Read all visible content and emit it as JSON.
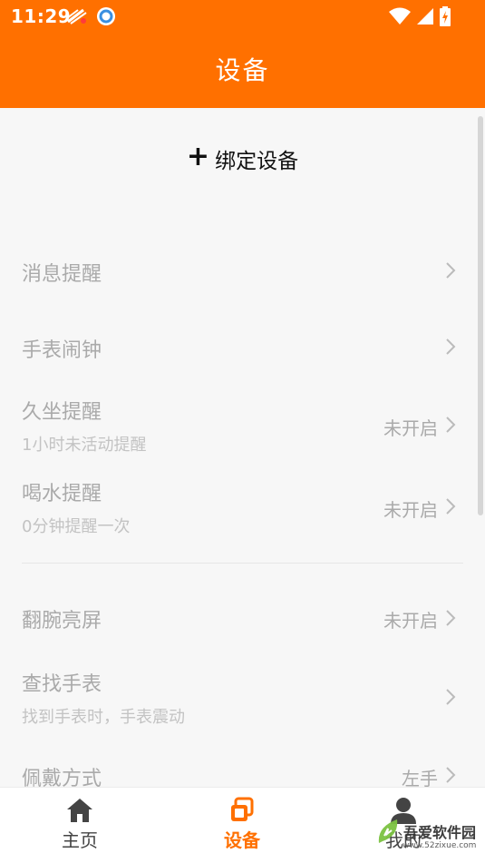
{
  "status_bar": {
    "time": "11:29"
  },
  "header": {
    "title": "设备"
  },
  "bind_button": {
    "plus": "+",
    "label": "绑定设备"
  },
  "settings": [
    {
      "label": "消息提醒",
      "sub": "",
      "value": ""
    },
    {
      "label": "手表闹钟",
      "sub": "",
      "value": ""
    },
    {
      "label": "久坐提醒",
      "sub": "1小时未活动提醒",
      "value": "未开启"
    },
    {
      "label": "喝水提醒",
      "sub": "0分钟提醒一次",
      "value": "未开启"
    },
    {
      "label": "翻腕亮屏",
      "sub": "",
      "value": "未开启"
    },
    {
      "label": "查找手表",
      "sub": "找到手表时，手表震动",
      "value": ""
    },
    {
      "label": "佩戴方式",
      "sub": "",
      "value": "左手"
    }
  ],
  "bottom_nav": {
    "home": "主页",
    "device": "设备",
    "mine": "我的"
  },
  "watermark": {
    "text": "吾爱软件园",
    "url": "www.52zixue.com"
  },
  "colors": {
    "accent": "#ff7000",
    "background": "#f7f7f7"
  }
}
